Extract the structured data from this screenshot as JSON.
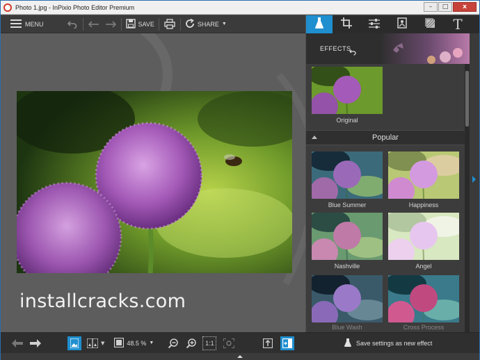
{
  "window": {
    "title": "Photo 1.jpg - InPixio Photo Editor Premium",
    "minimize_glyph": "–",
    "maximize_glyph": "□",
    "close_glyph": "x"
  },
  "toolbar": {
    "menu_label": "MENU",
    "save_label": "SAVE",
    "share_label": "SHARE"
  },
  "panel": {
    "effects_label": "EFFECTS",
    "original_label": "Original",
    "section_title": "Popular",
    "effects": [
      {
        "label": "Blue Summer"
      },
      {
        "label": "Happiness"
      },
      {
        "label": "Nashville"
      },
      {
        "label": "Angel"
      },
      {
        "label": "Blue Wash"
      },
      {
        "label": "Cross Process"
      }
    ]
  },
  "bottombar": {
    "zoom_value": "48.5 %",
    "fit_label": "1:1",
    "save_settings_label": "Save settings as new effect"
  },
  "watermark": "installcracks.com",
  "colors": {
    "accent": "#1f8fd0",
    "close": "#c7433a",
    "panel_bg": "#3c3c3c",
    "toolbar_bg": "#3b3b3b"
  }
}
